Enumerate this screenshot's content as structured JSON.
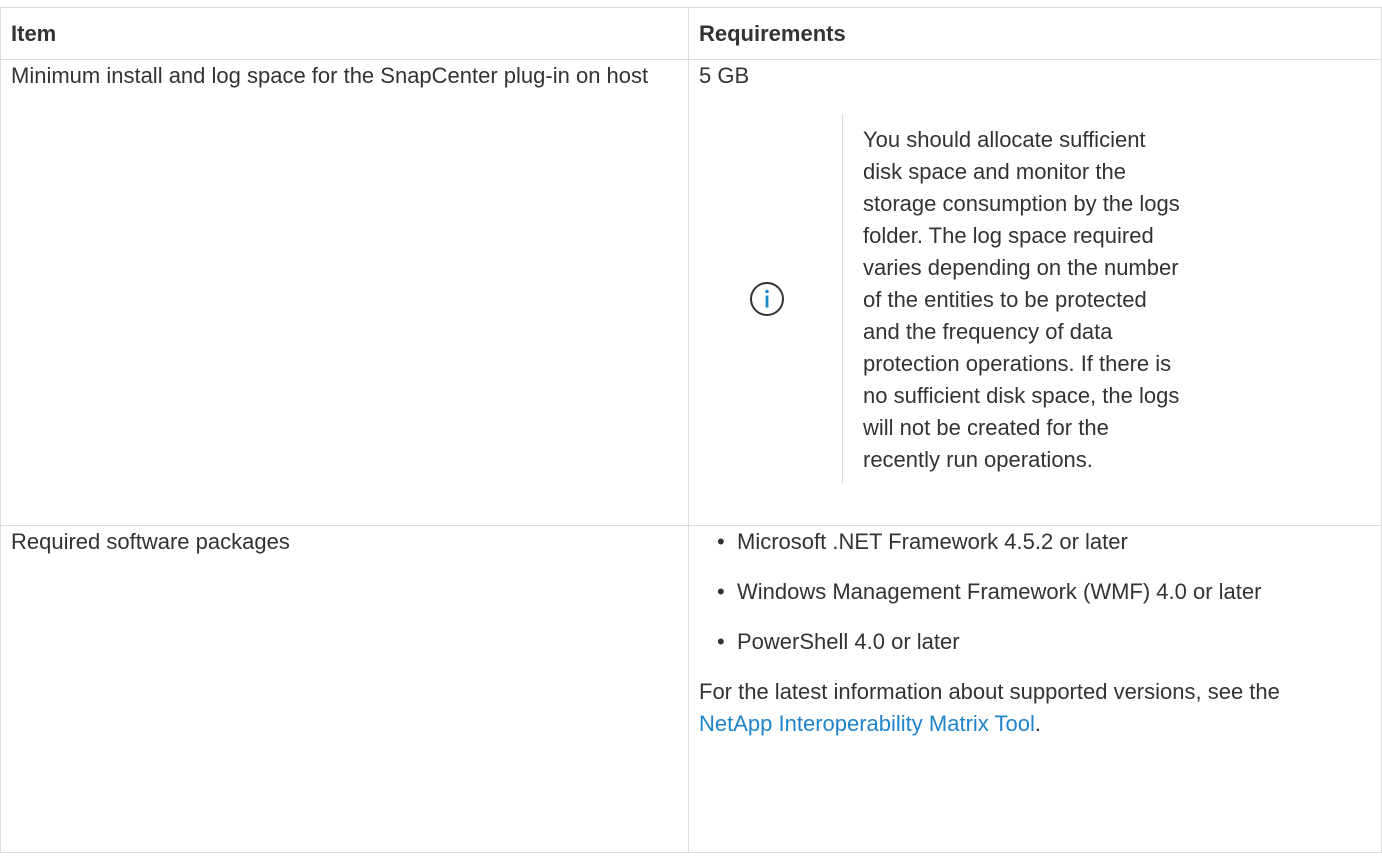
{
  "table": {
    "headers": [
      "Item",
      "Requirements"
    ],
    "rows": [
      {
        "item": "Minimum install and log space for the SnapCenter plug-in on host",
        "requirement": "5 GB",
        "note": {
          "icon": "info-icon",
          "text": "You should allocate sufficient disk space and monitor the storage consumption by the logs folder. The log space required varies depending on the number of the entities to be protected and the frequency of data protection operations. If there is no sufficient disk space, the logs will not be created for the recently run operations."
        }
      },
      {
        "item": "Required software packages",
        "packages": [
          "Microsoft .NET Framework 4.5.2 or later",
          "Windows Management Framework (WMF) 4.0 or later",
          "PowerShell 4.0 or later"
        ],
        "bullet": "•",
        "footer_before": "For the latest information about supported versions, see the ",
        "footer_link": "NetApp Interoperability Matrix Tool",
        "footer_after": "."
      }
    ]
  },
  "colors": {
    "text": "#333333",
    "border": "#dcdcdc",
    "link": "#1f84ca",
    "icon": "#1f84ca"
  }
}
